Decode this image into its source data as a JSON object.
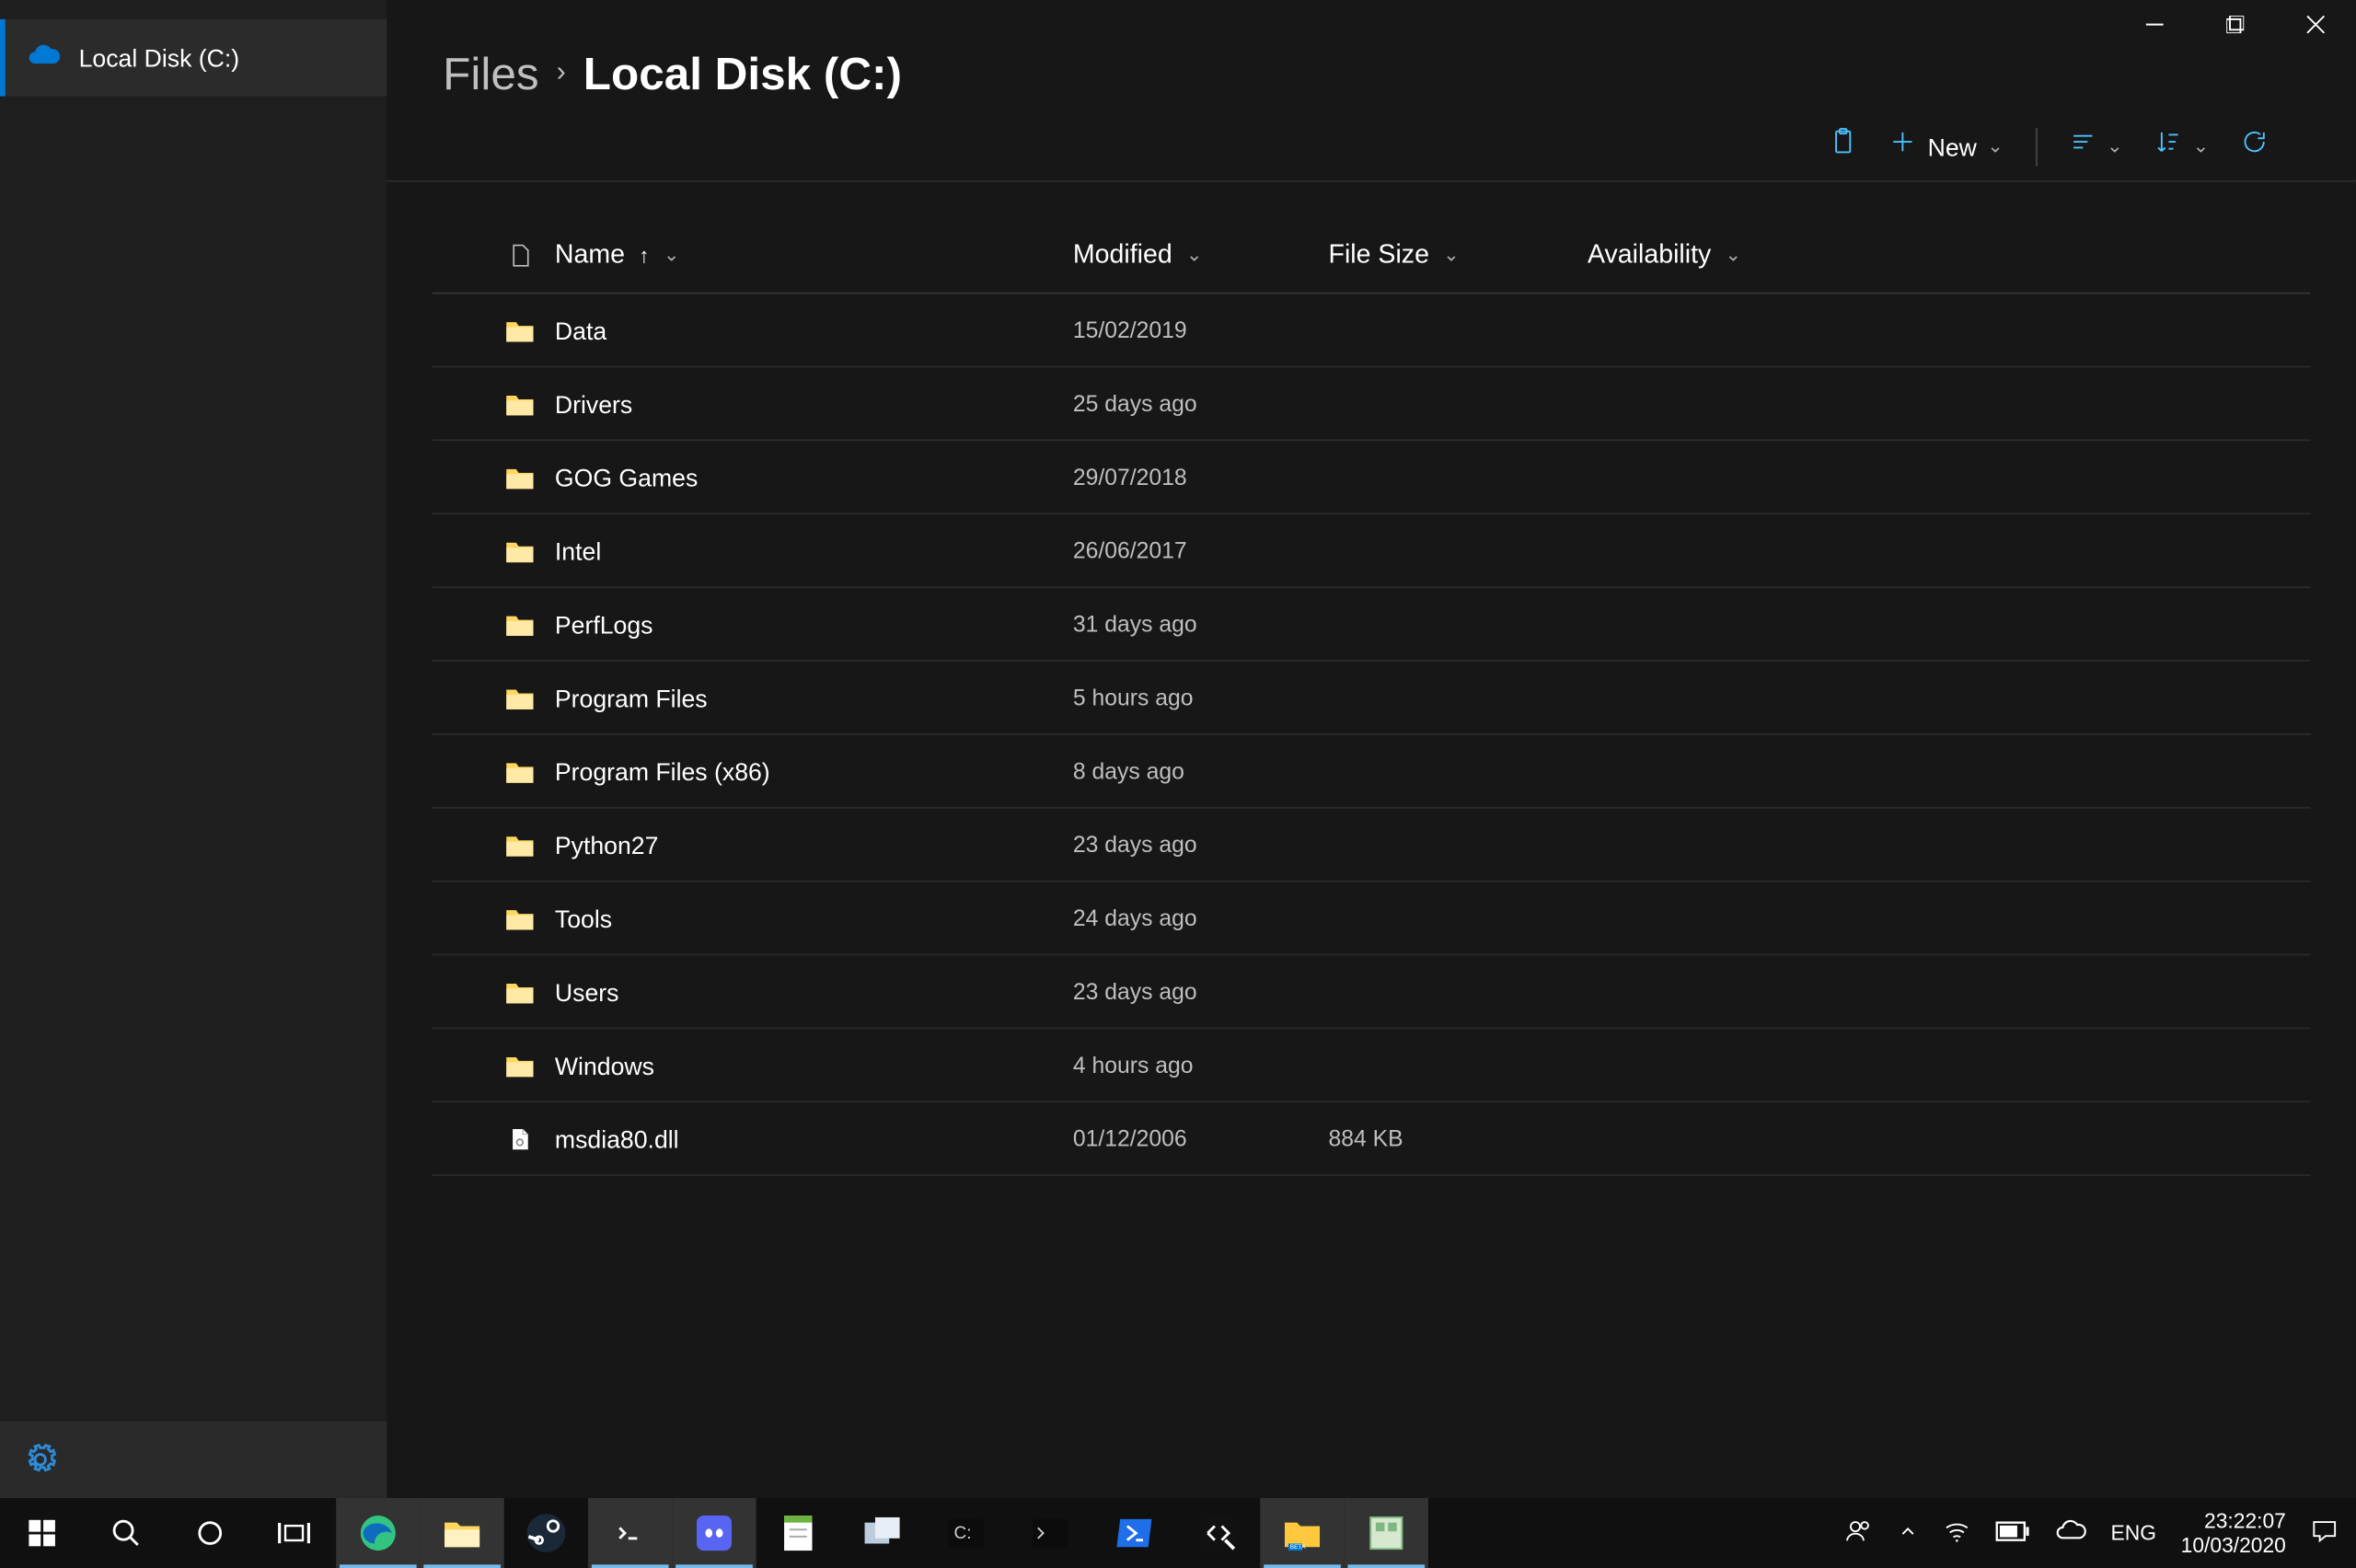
{
  "window": {
    "tab_label": "Local Disk (C:)"
  },
  "breadcrumb": {
    "root": "Files",
    "current": "Local Disk (C:)"
  },
  "toolbar": {
    "new_label": "New"
  },
  "columns": {
    "name": "Name",
    "modified": "Modified",
    "size": "File Size",
    "availability": "Availability"
  },
  "rows": [
    {
      "type": "folder",
      "name": "Data",
      "modified": "15/02/2019",
      "size": ""
    },
    {
      "type": "folder",
      "name": "Drivers",
      "modified": "25 days ago",
      "size": ""
    },
    {
      "type": "folder",
      "name": "GOG Games",
      "modified": "29/07/2018",
      "size": ""
    },
    {
      "type": "folder",
      "name": "Intel",
      "modified": "26/06/2017",
      "size": ""
    },
    {
      "type": "folder",
      "name": "PerfLogs",
      "modified": "31 days ago",
      "size": ""
    },
    {
      "type": "folder",
      "name": "Program Files",
      "modified": "5 hours ago",
      "size": ""
    },
    {
      "type": "folder",
      "name": "Program Files (x86)",
      "modified": "8 days ago",
      "size": ""
    },
    {
      "type": "folder",
      "name": "Python27",
      "modified": "23 days ago",
      "size": ""
    },
    {
      "type": "folder",
      "name": "Tools",
      "modified": "24 days ago",
      "size": ""
    },
    {
      "type": "folder",
      "name": "Users",
      "modified": "23 days ago",
      "size": ""
    },
    {
      "type": "folder",
      "name": "Windows",
      "modified": "4 hours ago",
      "size": ""
    },
    {
      "type": "file",
      "name": "msdia80.dll",
      "modified": "01/12/2006",
      "size": "884 KB"
    }
  ],
  "systray": {
    "lang": "ENG",
    "time": "23:22:07",
    "date": "10/03/2020"
  }
}
